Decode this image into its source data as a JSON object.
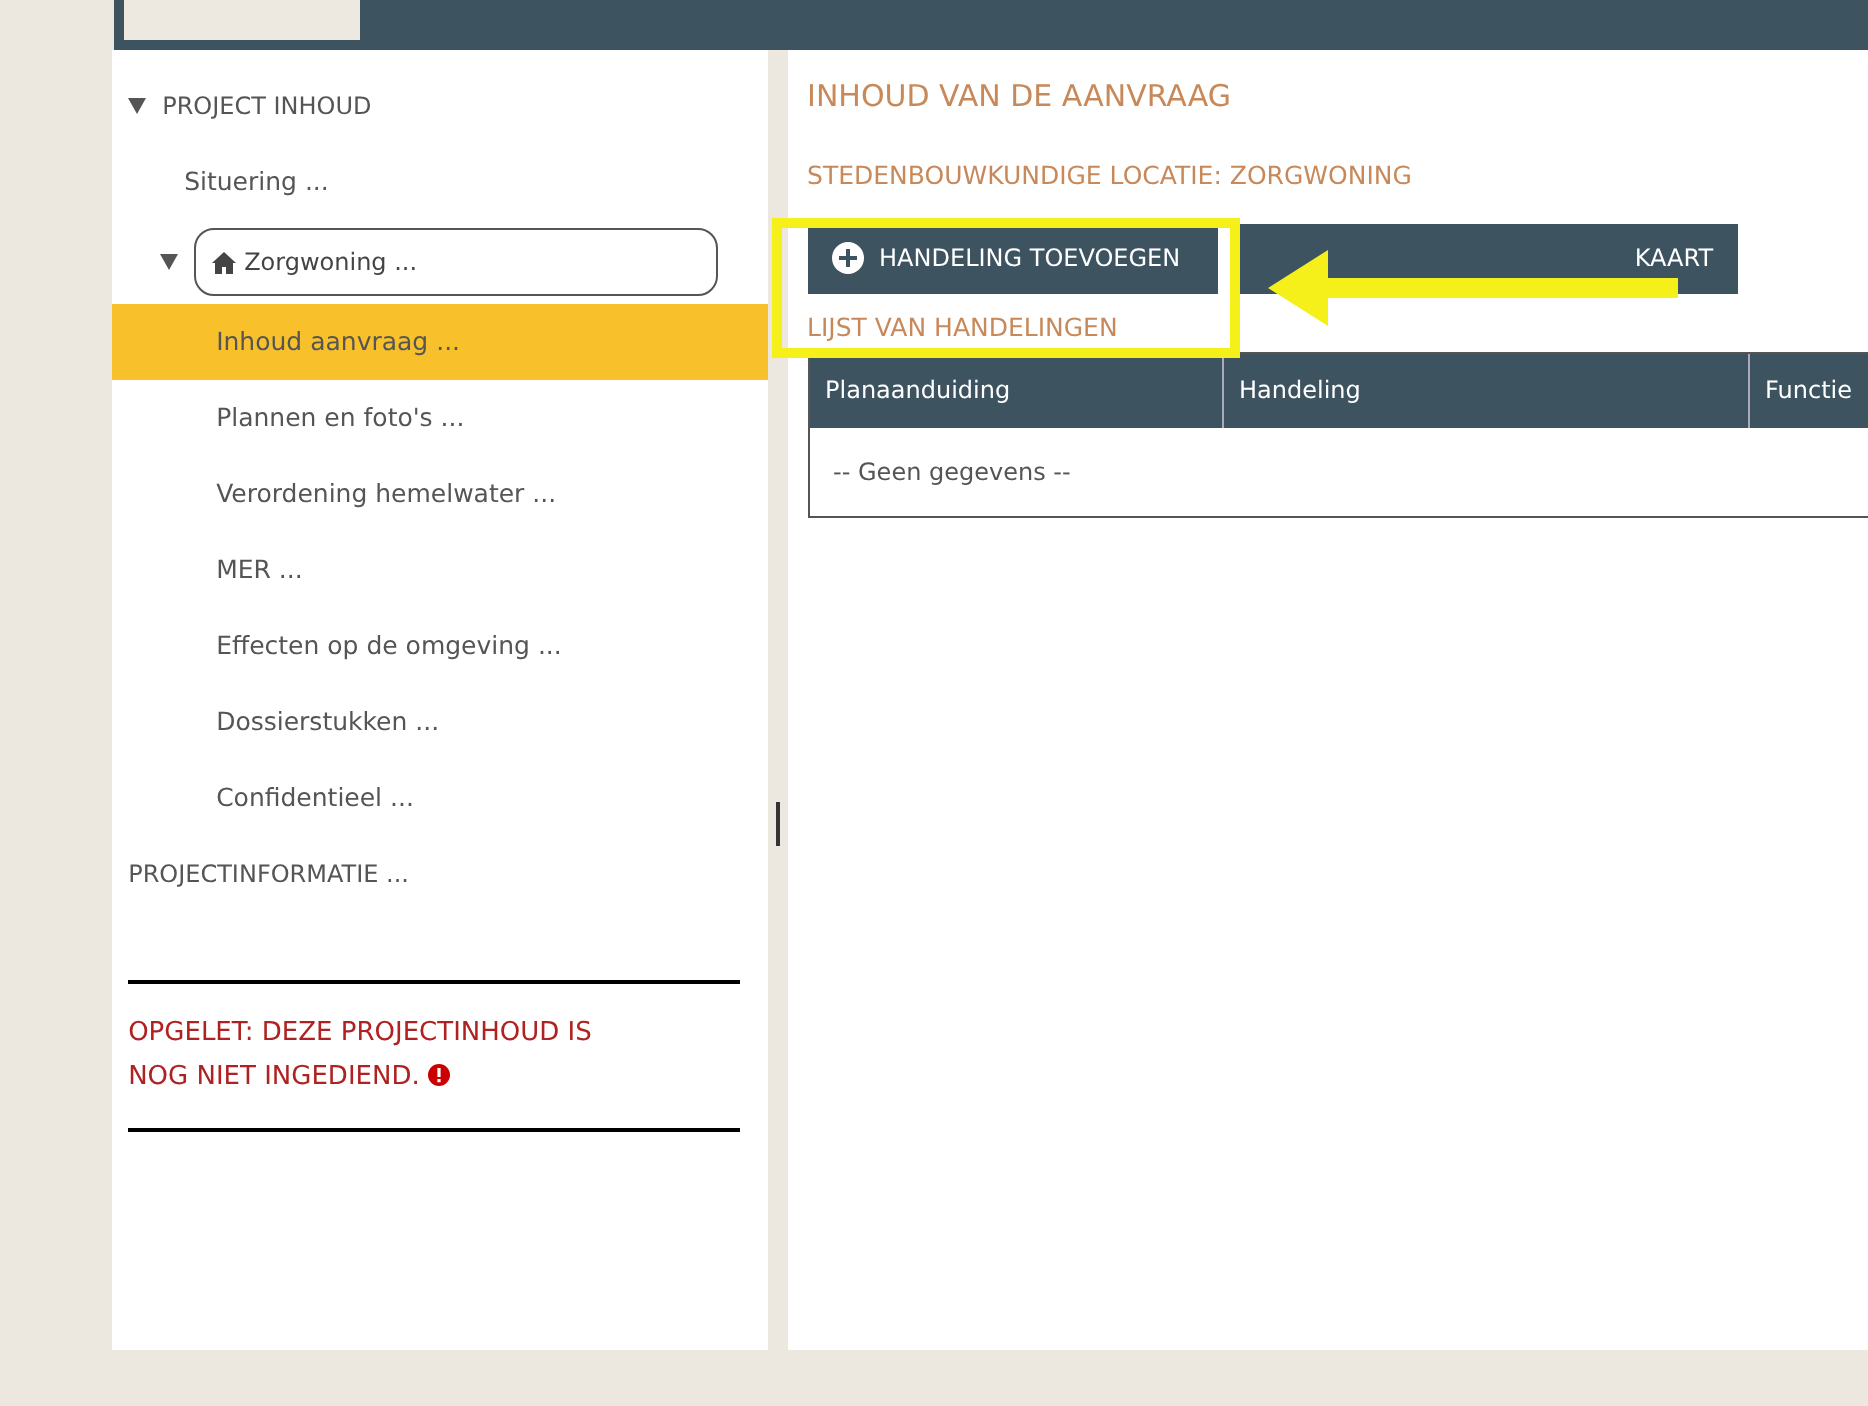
{
  "sidebar": {
    "items": [
      {
        "label": "PROJECT INHOUD",
        "kind": "section",
        "expanded": true,
        "selected": false,
        "children": [
          {
            "label": "Situering ...",
            "kind": "item",
            "selected": false
          },
          {
            "label": "Zorgwoning ...",
            "kind": "location",
            "expanded": true,
            "selected": false,
            "children": [
              {
                "label": "Inhoud aanvraag ...",
                "kind": "item",
                "selected": true
              },
              {
                "label": "Plannen en foto's ...",
                "kind": "item",
                "selected": false
              },
              {
                "label": "Verordening hemelwater ...",
                "kind": "item",
                "selected": false
              },
              {
                "label": "MER ...",
                "kind": "item",
                "selected": false
              },
              {
                "label": "Effecten op de omgeving ...",
                "kind": "item",
                "selected": false
              },
              {
                "label": "Dossierstukken ...",
                "kind": "item",
                "selected": false
              },
              {
                "label": "Confidentieel ...",
                "kind": "item",
                "selected": false
              }
            ]
          }
        ]
      },
      {
        "label": "PROJECTINFORMATIE ...",
        "kind": "section",
        "selected": false
      }
    ],
    "warning": "OPGELET: DEZE PROJECTINHOUD IS NOG NIET INGEDIEND."
  },
  "main": {
    "title": "INHOUD VAN DE AANVRAAG",
    "subtitle": "STEDENBOUWKUNDIGE LOCATIE: ZORGWONING",
    "buttons": [
      {
        "label": "HANDELING TOEVOEGEN",
        "kind": "add"
      },
      {
        "label": "KAART",
        "kind": "map"
      }
    ],
    "list_title": "LIJST VAN HANDELINGEN",
    "table": {
      "columns": [
        "Planaanduiding",
        "Handeling",
        "Functie"
      ],
      "empty": "-- Geen gegevens --"
    }
  }
}
